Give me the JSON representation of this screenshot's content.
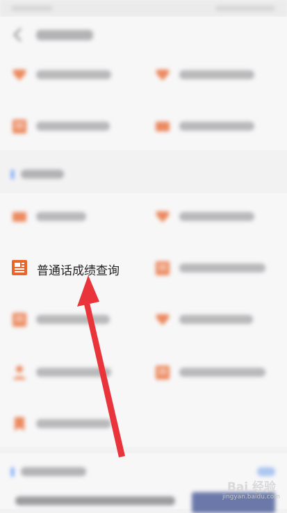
{
  "highlighted_item": {
    "label": "普通话成绩查询",
    "icon": "document-icon"
  },
  "colors": {
    "accent_orange": "#e8652b",
    "arrow_red": "#e8343a",
    "section_blue": "#3b82f6"
  },
  "watermark": {
    "main": "Bai 经验",
    "sub": "jingyan.baidu.com"
  }
}
